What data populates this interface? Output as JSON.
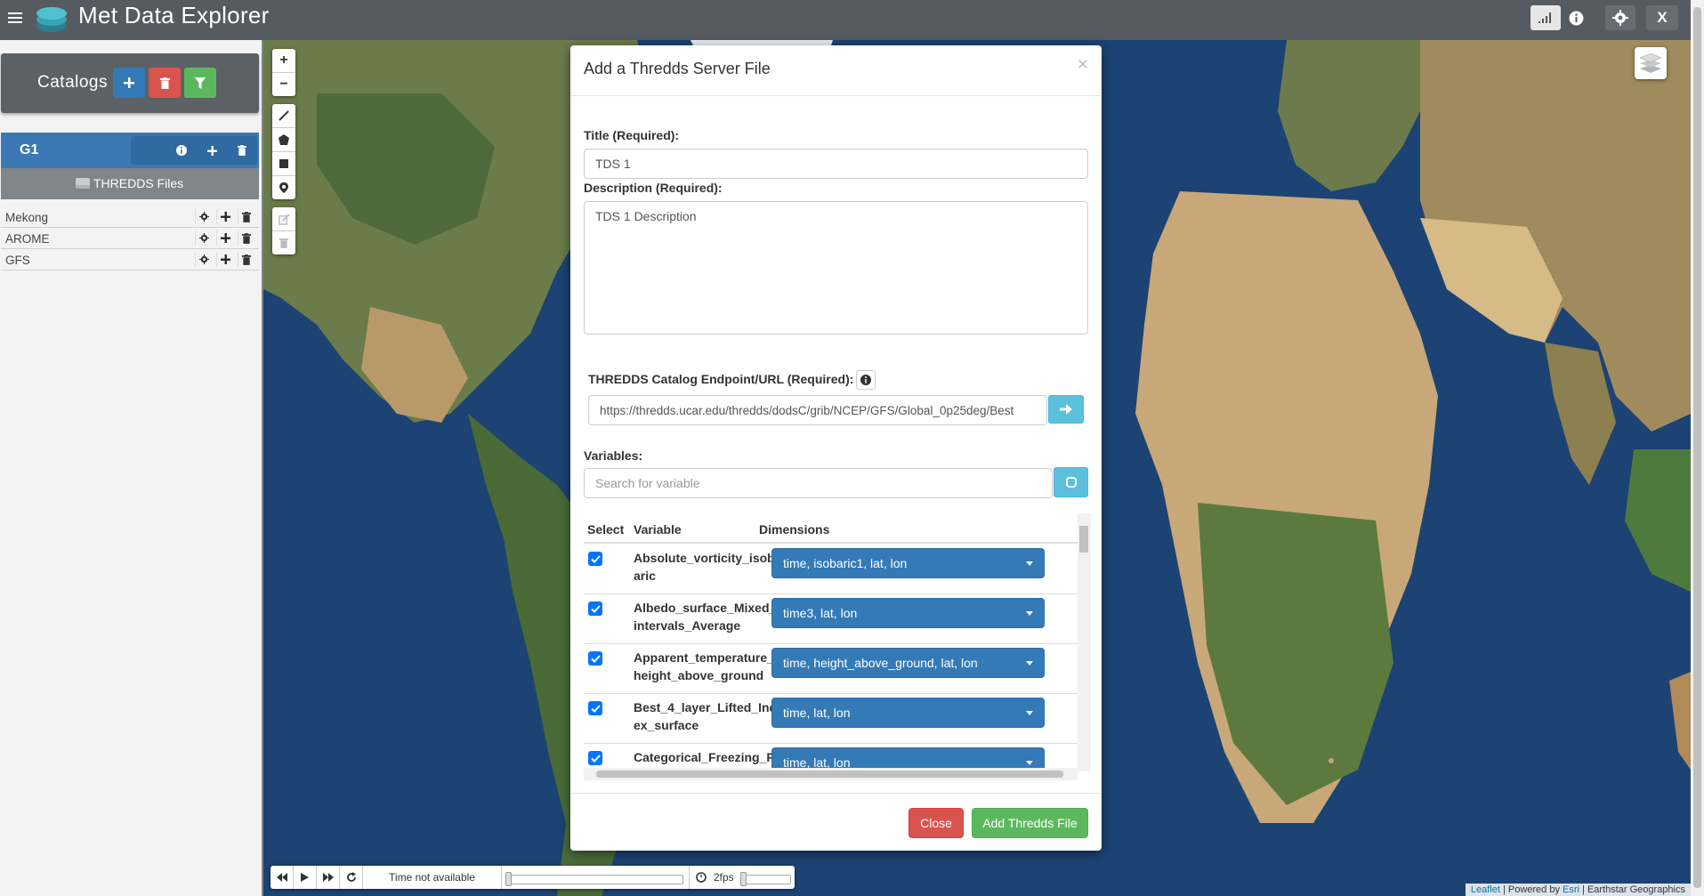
{
  "app": {
    "title": "Met Data Explorer",
    "nav_close_label": "X"
  },
  "sidebar": {
    "catalogs_title": "Catalogs",
    "group": {
      "title": "G1",
      "files_header": "THREDDS Files",
      "files": [
        {
          "name": "Mekong"
        },
        {
          "name": "AROME"
        },
        {
          "name": "GFS"
        }
      ]
    }
  },
  "map": {
    "time_label": "Time not available",
    "fps_label": "2fps",
    "attribution": {
      "leaflet": "Leaflet",
      "powered_by": " | Powered by ",
      "esri": "Esri",
      "rest": " | Earthstar Geographics"
    }
  },
  "modal": {
    "title": "Add a Thredds Server File",
    "close_x": "×",
    "title_label": "Title (Required):",
    "title_value": "TDS 1",
    "description_label": "Description (Required):",
    "description_value": "TDS 1 Description",
    "url_label": "THREDDS Catalog Endpoint/URL (Required):",
    "url_value": "https://thredds.ucar.edu/thredds/dodsC/grib/NCEP/GFS/Global_0p25deg/Best",
    "variables_label": "Variables:",
    "search_placeholder": "Search for variable",
    "columns": [
      "Select",
      "Variable",
      "Dimensions"
    ],
    "variables": [
      {
        "name": "Absolute_vorticity_isobaric",
        "dims": "time, isobaric1, lat, lon",
        "checked": true
      },
      {
        "name": "Albedo_surface_Mixed_intervals_Average",
        "dims": "time3, lat, lon",
        "checked": true
      },
      {
        "name": "Apparent_temperature_height_above_ground",
        "dims": "time, height_above_ground, lat, lon",
        "checked": true
      },
      {
        "name": "Best_4_layer_Lifted_Index_surface",
        "dims": "time, lat, lon",
        "checked": true
      },
      {
        "name": "Categorical_Freezing_R",
        "dims": "time, lat, lon",
        "checked": true
      }
    ],
    "close_button": "Close",
    "add_button": "Add Thredds File"
  },
  "colors": {
    "navbar": "#555b61",
    "primary": "#337ab7",
    "danger": "#d9534f",
    "success": "#5cb85c",
    "info": "#5bc0de"
  }
}
